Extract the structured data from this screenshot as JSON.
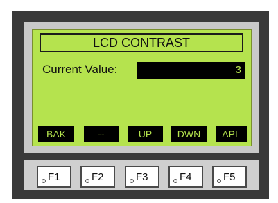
{
  "lcd": {
    "title": "LCD CONTRAST",
    "current_value_label": "Current Value:",
    "current_value": "3",
    "softkeys": [
      "BAK",
      "--",
      "UP",
      "DWN",
      "APL"
    ]
  },
  "function_keys": [
    "F1",
    "F2",
    "F3",
    "F4",
    "F5"
  ],
  "colors": {
    "lcd_background": "#b5e34e",
    "device_body": "#3a3a3a",
    "bezel": "#c9c9c9"
  }
}
